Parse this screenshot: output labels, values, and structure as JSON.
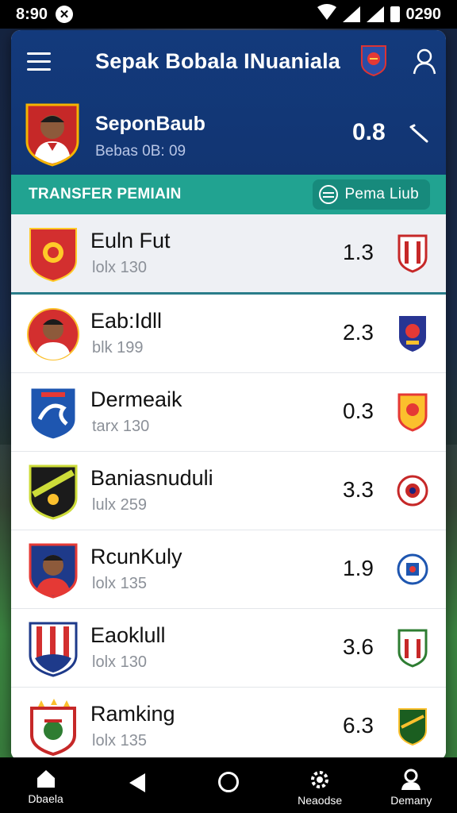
{
  "status_bar": {
    "time": "8:90",
    "badge": "✕",
    "right_text": "0290"
  },
  "header": {
    "title": "Sepak Bobala INuaniala",
    "user_name": "SeponBaub",
    "user_sub": "Bebas 0B: 09",
    "score": "0.8"
  },
  "section": {
    "title": "TRANSFER PEMIAIN",
    "button_label": "Pema Liub"
  },
  "rows": [
    {
      "name": "Euln Fut",
      "sub": "lolx 130",
      "value": "1.3"
    },
    {
      "name": "Eab:Idll",
      "sub": "blk 199",
      "value": "2.3"
    },
    {
      "name": "Dermeaik",
      "sub": "tarx 130",
      "value": "0.3"
    },
    {
      "name": "Baniasnuduli",
      "sub": "lulx 259",
      "value": "3.3"
    },
    {
      "name": "RcunKuly",
      "sub": "lolx 135",
      "value": "1.9"
    },
    {
      "name": "Eaoklull",
      "sub": "lolx 130",
      "value": "3.6"
    },
    {
      "name": "Ramking",
      "sub": "lolx 135",
      "value": "6.3"
    }
  ],
  "bottom_nav": [
    {
      "label": "Dbaela",
      "icon": "home-icon"
    },
    {
      "label": "",
      "icon": "back-icon"
    },
    {
      "label": "",
      "icon": "home-circle-icon"
    },
    {
      "label": "Neaodse",
      "icon": "settings-icon"
    },
    {
      "label": "Demany",
      "icon": "profile-icon"
    }
  ],
  "colors": {
    "header": "#133a7c",
    "section": "#21a391",
    "accent_line": "#2a7d8a"
  }
}
